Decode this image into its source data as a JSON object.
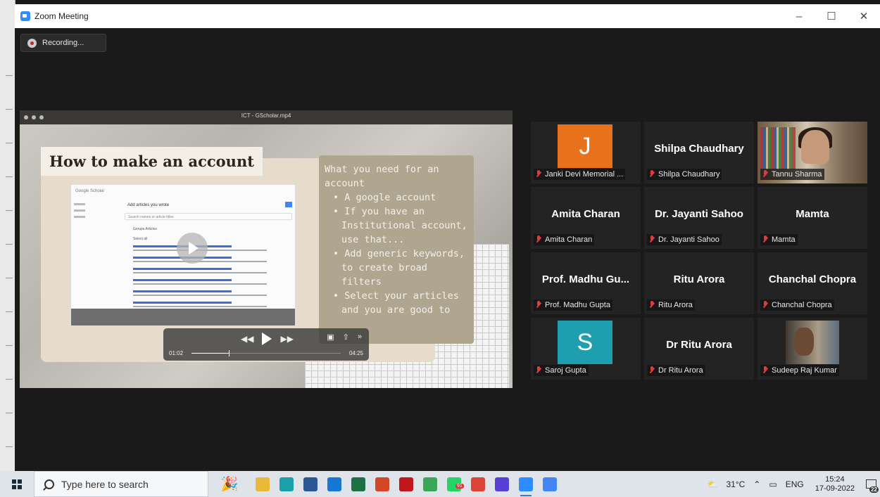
{
  "window": {
    "title": "Zoom Meeting",
    "minimize": "–",
    "maximize": "☐",
    "close": "✕"
  },
  "recording": {
    "label": "Recording..."
  },
  "share": {
    "video_title": "ICT - GScholar.mp4",
    "slide_title": "How to make an account",
    "notes_heading": "What you need for an account",
    "notes_items": [
      "A google account",
      "If you have an Institutional account, use that...",
      "Add generic keywords, to create broad filters",
      "Select your articles and you are good to"
    ],
    "scholar": {
      "logo": "Google Scholar",
      "header": "Add articles you wrote",
      "search_placeholder": "Search names or article titles",
      "tabs": "Groups    Articles",
      "select_all": "Select all"
    },
    "player": {
      "current_time": "01:02",
      "total_time": "04:25",
      "progress": 0.25,
      "rewind": "◀◀",
      "forward": "▶▶",
      "more": "»"
    }
  },
  "participants": [
    {
      "tile_name": "",
      "label": "Janki  Devi Memorial ...",
      "initial": "J",
      "avatar_color": "#e8731c",
      "type": "avatar"
    },
    {
      "tile_name": "Shilpa Chaudhary",
      "label": "Shilpa Chaudhary",
      "type": "name"
    },
    {
      "tile_name": "",
      "label": "Tannu Sharma",
      "type": "video",
      "active": true
    },
    {
      "tile_name": "Amita Charan",
      "label": "Amita Charan",
      "type": "name"
    },
    {
      "tile_name": "Dr. Jayanti Sahoo",
      "label": "Dr. Jayanti Sahoo",
      "type": "name"
    },
    {
      "tile_name": "Mamta",
      "label": "Mamta",
      "type": "name"
    },
    {
      "tile_name": "Prof. Madhu Gu...",
      "label": "Prof. Madhu Gupta",
      "type": "name"
    },
    {
      "tile_name": "Ritu Arora",
      "label": "Ritu Arora",
      "type": "name"
    },
    {
      "tile_name": "Chanchal Chopra",
      "label": "Chanchal Chopra",
      "type": "name"
    },
    {
      "tile_name": "",
      "label": "Saroj Gupta",
      "initial": "S",
      "avatar_color": "#1e9fb0",
      "type": "avatar"
    },
    {
      "tile_name": "Dr Ritu Arora",
      "label": "Dr Ritu Arora",
      "type": "name"
    },
    {
      "tile_name": "",
      "label": "Sudeep Raj Kumar",
      "type": "video"
    }
  ],
  "taskbar": {
    "search_placeholder": "Type here to search",
    "apps": [
      {
        "icon": "file-explorer-icon",
        "color": "#e9b93a"
      },
      {
        "icon": "edge-icon",
        "color": "#1aa0a8"
      },
      {
        "icon": "word-icon",
        "color": "#2b5797"
      },
      {
        "icon": "mail-icon",
        "color": "#1877d2"
      },
      {
        "icon": "excel-icon",
        "color": "#1e7145"
      },
      {
        "icon": "powerpoint-icon",
        "color": "#d24726"
      },
      {
        "icon": "netflix-icon",
        "color": "#c0171d"
      },
      {
        "icon": "app-green-icon",
        "color": "#3aa757"
      },
      {
        "icon": "whatsapp-icon",
        "color": "#25d366",
        "badge": "91"
      },
      {
        "icon": "chrome-icon",
        "color": "#db4437"
      },
      {
        "icon": "webex-icon",
        "color": "#5a3fd6"
      },
      {
        "icon": "zoom-icon",
        "color": "#2d8cff",
        "active": true
      },
      {
        "icon": "chrome-blue-icon",
        "color": "#4285f4"
      }
    ],
    "weather": "31°C",
    "language": "ENG",
    "time": "15:24",
    "date": "17-09-2022",
    "notifications": "22"
  }
}
